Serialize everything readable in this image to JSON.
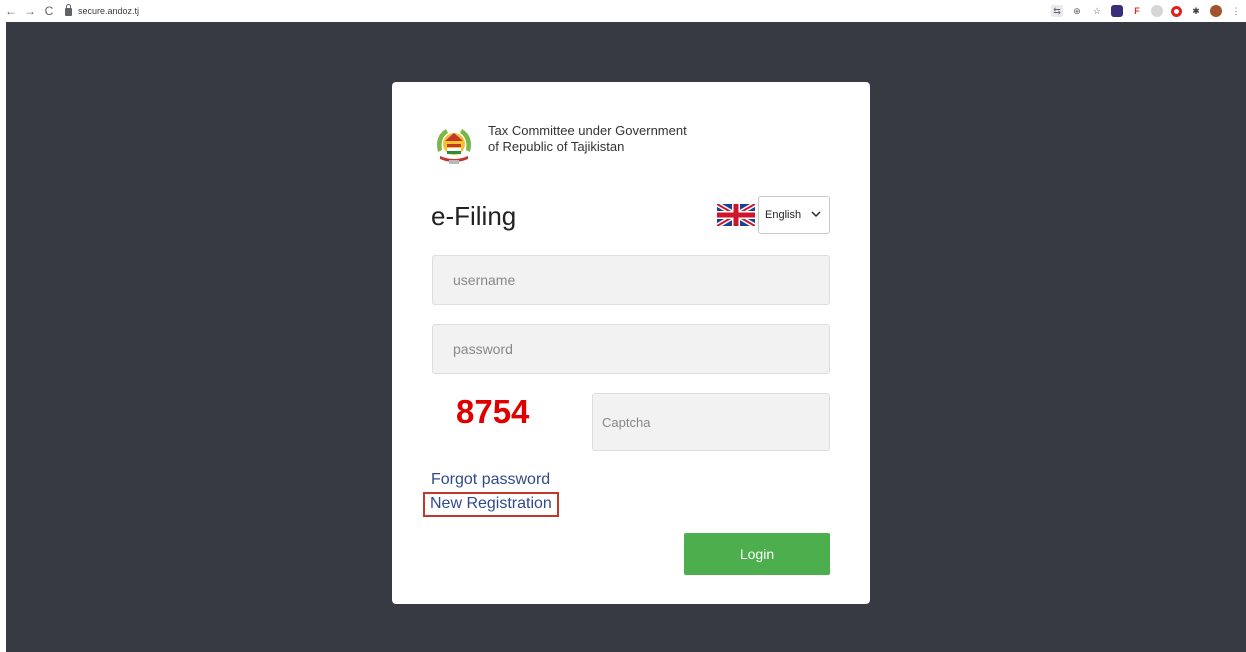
{
  "browser": {
    "nav": {
      "back": "←",
      "forward": "→",
      "reload": "C"
    },
    "url": "secure.andoz.tj",
    "extensions": [
      "translate-icon",
      "zoom-icon",
      "bookmark-star-icon",
      "extension-puzzle-icon",
      "f-extension-icon",
      "circle-extension-icon",
      "opera-icon",
      "pin-icon",
      "profile-avatar",
      "menu-dots-icon"
    ]
  },
  "card": {
    "org_line1": "Tax Committee under Government",
    "org_line2": "of Republic of Tajikistan",
    "title": "e-Filing",
    "language": {
      "selected": "English"
    },
    "username_placeholder": "username",
    "password_placeholder": "password",
    "captcha_code": "8754",
    "captcha_placeholder": "Captcha",
    "forgot_link": "Forgot password",
    "new_registration_link": "New Registration",
    "login_label": "Login"
  },
  "colors": {
    "page_bg": "#373a42",
    "captcha": "#e00000",
    "link": "#2f4a8c",
    "login_button": "#4cae4c",
    "highlight_border": "#c0392b"
  }
}
